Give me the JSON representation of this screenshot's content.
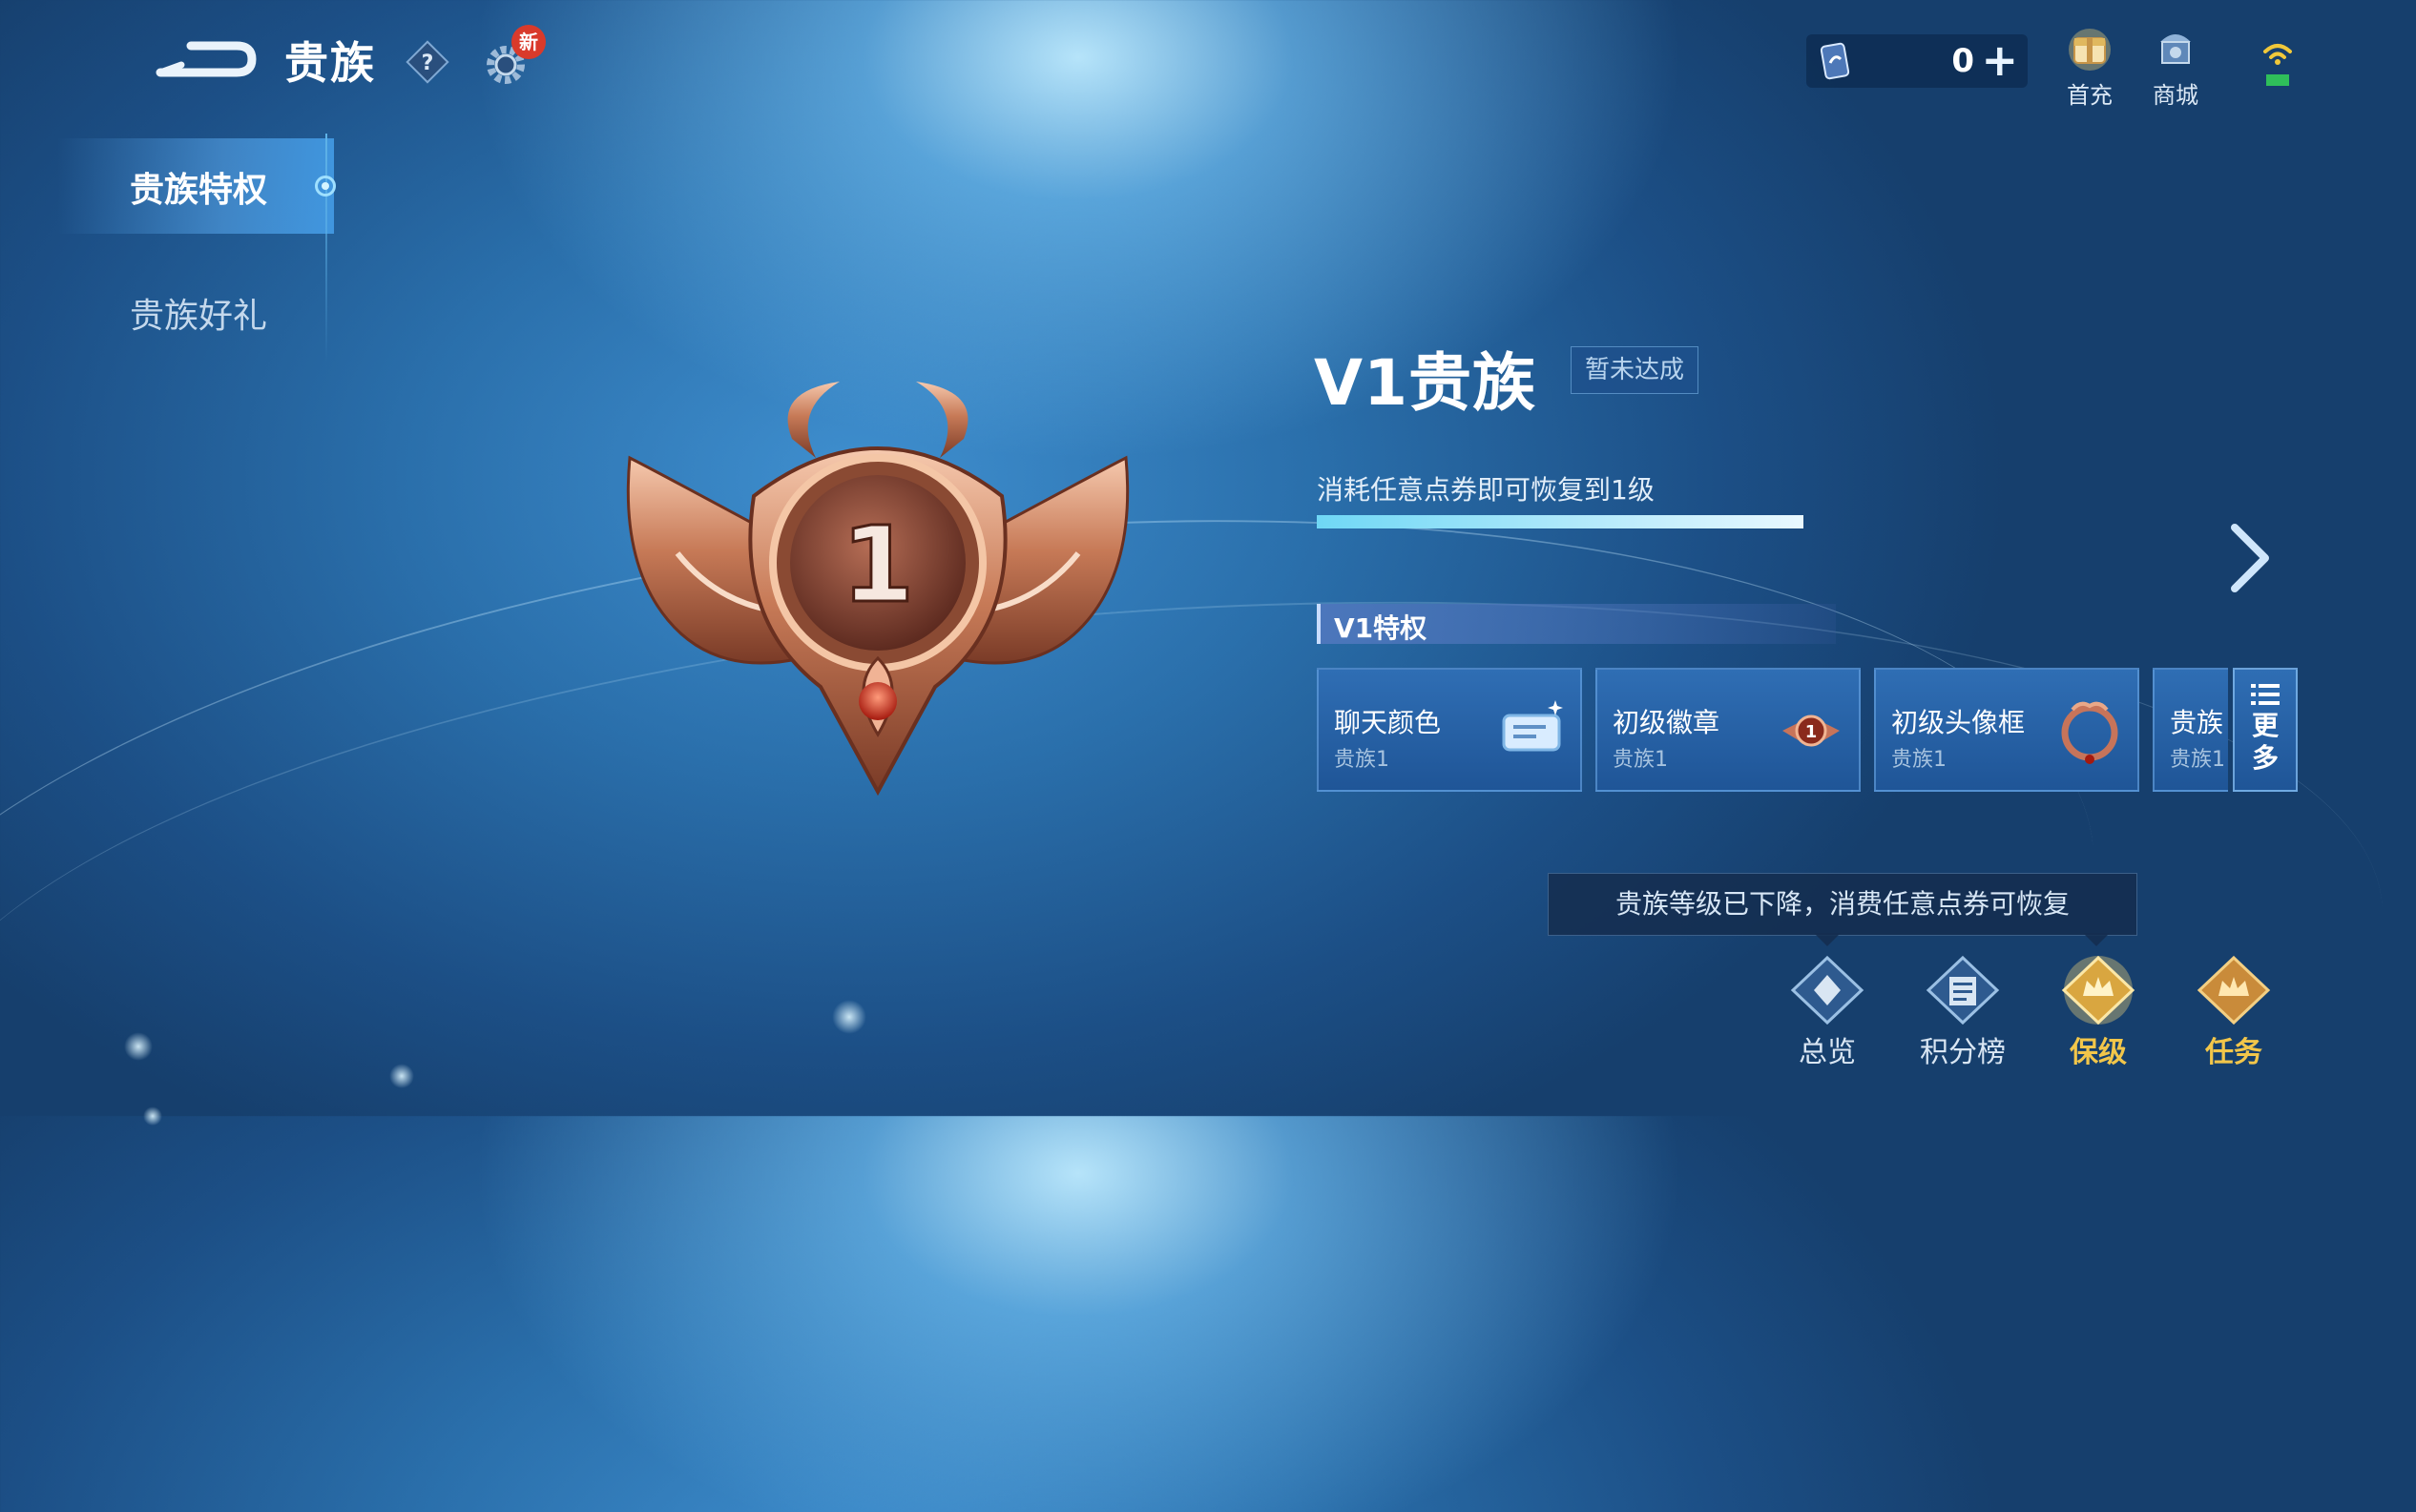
{
  "header": {
    "title": "贵族",
    "new_badge": "新",
    "currency_amount": "0",
    "currency_plus": "+",
    "first_recharge_label": "首充",
    "shop_label": "商城"
  },
  "sidebar": {
    "items": [
      {
        "label": "贵族特权",
        "active": true
      },
      {
        "label": "贵族好礼",
        "active": false
      }
    ]
  },
  "emblem": {
    "level_number": "1"
  },
  "level": {
    "title": "V1贵族",
    "status": "暂未达成",
    "hint": "消耗任意点券即可恢复到1级",
    "progress": 1.0
  },
  "privileges": {
    "header": "V1特权",
    "cards": [
      {
        "name": "聊天颜色",
        "sub": "贵族1",
        "icon": "chat-bubble-icon"
      },
      {
        "name": "初级徽章",
        "sub": "贵族1",
        "icon": "badge-icon"
      },
      {
        "name": "初级头像框",
        "sub": "贵族1",
        "icon": "avatar-frame-icon"
      },
      {
        "name": "贵族",
        "sub": "贵族1",
        "icon": "gift-icon"
      }
    ],
    "more_label_1": "更",
    "more_label_2": "多"
  },
  "tooltip": "贵族等级已下降，消费任意点券可恢复",
  "bottom_nav": [
    {
      "label": "总览",
      "color": "#d9e6f3"
    },
    {
      "label": "积分榜",
      "color": "#d9e6f3"
    },
    {
      "label": "保级",
      "color": "#f2c64a"
    },
    {
      "label": "任务",
      "color": "#f2c64a"
    }
  ],
  "colors": {
    "accent_gold": "#f2c64a",
    "bronze": "#b8674a",
    "progress": "#9fe6fa"
  }
}
